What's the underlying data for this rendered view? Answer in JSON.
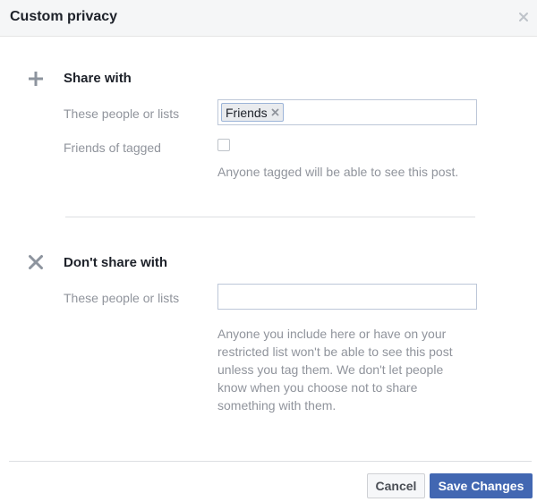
{
  "dialog": {
    "title": "Custom privacy",
    "close_icon": "close-icon"
  },
  "share_with": {
    "icon": "plus-icon",
    "title": "Share with",
    "people_label": "These people or lists",
    "tokens": [
      {
        "label": "Friends",
        "remove_icon": "remove-icon"
      }
    ],
    "friends_of_tagged_label": "Friends of tagged",
    "friends_of_tagged_checked": false,
    "helper": "Anyone tagged will be able to see this post."
  },
  "dont_share_with": {
    "icon": "x-icon",
    "title": "Don't share with",
    "people_label": "These people or lists",
    "input_value": "",
    "helper_lines": [
      "Anyone you include here or have on your",
      "restricted list won't be able to see this post",
      "unless you tag them. We don't let people",
      "know when you choose not to share",
      "something with them."
    ]
  },
  "footer": {
    "cancel_label": "Cancel",
    "save_label": "Save Changes"
  },
  "colors": {
    "primary": "#4267b2",
    "muted_text": "#90949c",
    "icon_gray": "#8d949e"
  }
}
